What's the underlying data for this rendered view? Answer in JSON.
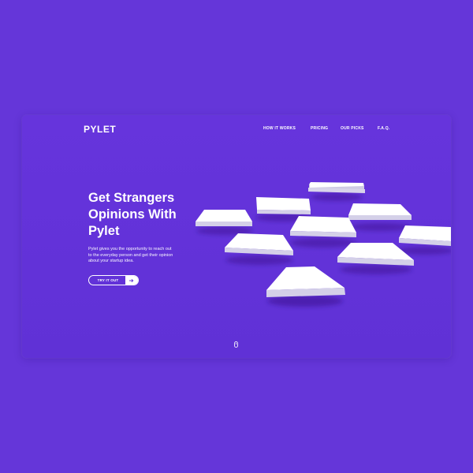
{
  "brand": {
    "logo": "PYLET"
  },
  "nav": {
    "items": [
      {
        "label": "HOW IT WORKS"
      },
      {
        "label": "PRICING"
      },
      {
        "label": "OUR PICKS"
      },
      {
        "label": "F.A.Q."
      }
    ]
  },
  "hero": {
    "headline_line1": "Get Strangers",
    "headline_line2": "Opinions With",
    "headline_line3": "Pylet",
    "subtext_line1": "Pylet gives you the opportunity to reach out",
    "subtext_line2": "to the everyday person and get their opinion",
    "subtext_line3": "about your startup idea.",
    "cta_label": "TRY IT OUT",
    "cta_icon": "arrow-right-icon"
  },
  "scroll": {
    "icon": "mouse-scroll-icon"
  },
  "colors": {
    "background": "#6536d9",
    "accent": "#ffffff"
  }
}
